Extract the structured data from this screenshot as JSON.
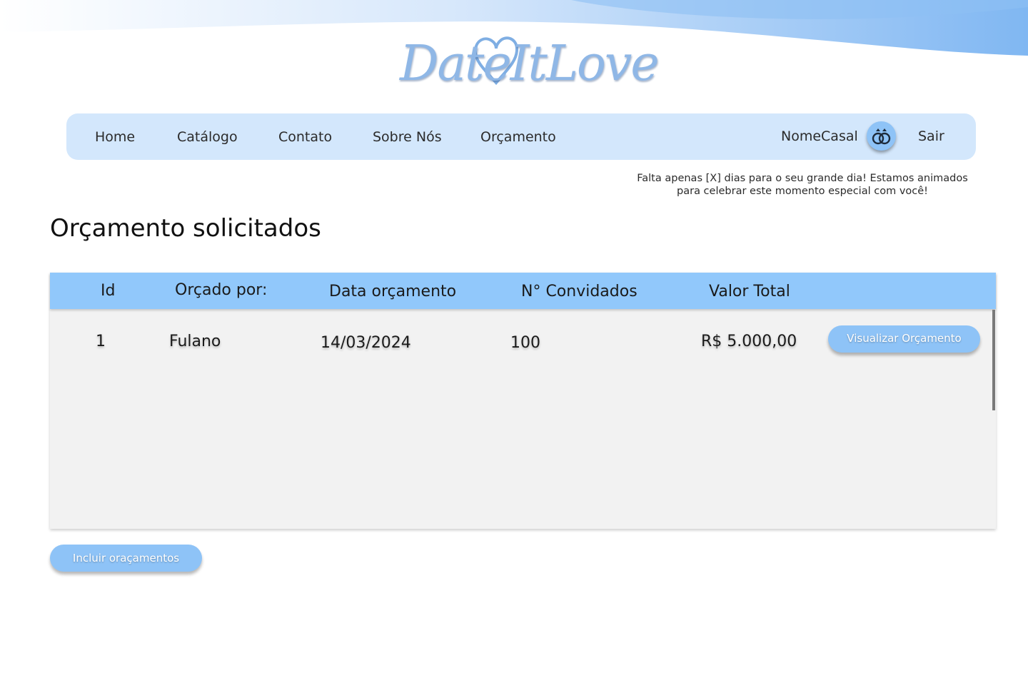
{
  "brand": {
    "logo_text": "DateItLove"
  },
  "nav": {
    "items": [
      "Home",
      "Catálogo",
      "Contato",
      "Sobre Nós",
      "Orçamento"
    ],
    "couple_name": "NomeCasal",
    "logout_label": "Sair"
  },
  "countdown": {
    "line1": "Falta apenas [X] dias para o seu grande dia! Estamos animados",
    "line2": "para celebrar este momento especial com você!"
  },
  "page": {
    "title": "Orçamento solicitados"
  },
  "table": {
    "headers": [
      "Id",
      "Orçado por:",
      "Data orçamento",
      "N° Convidados",
      "Valor Total"
    ],
    "rows": [
      {
        "id": "1",
        "requested_by": "Fulano",
        "date": "14/03/2024",
        "guests": "100",
        "total": "R$ 5.000,00",
        "action_label": "Visualizar Orçamento"
      }
    ]
  },
  "actions": {
    "add_label": "Incluir oraçamentos"
  },
  "colors": {
    "nav_bg": "#d3e7fc",
    "table_header_bg": "#91c8fb",
    "button_bg": "#8ec3f7",
    "table_body_bg": "#f2f2f2"
  },
  "icons": {
    "avatar": "wedding-rings-icon",
    "logo": "heart-logo-icon"
  }
}
